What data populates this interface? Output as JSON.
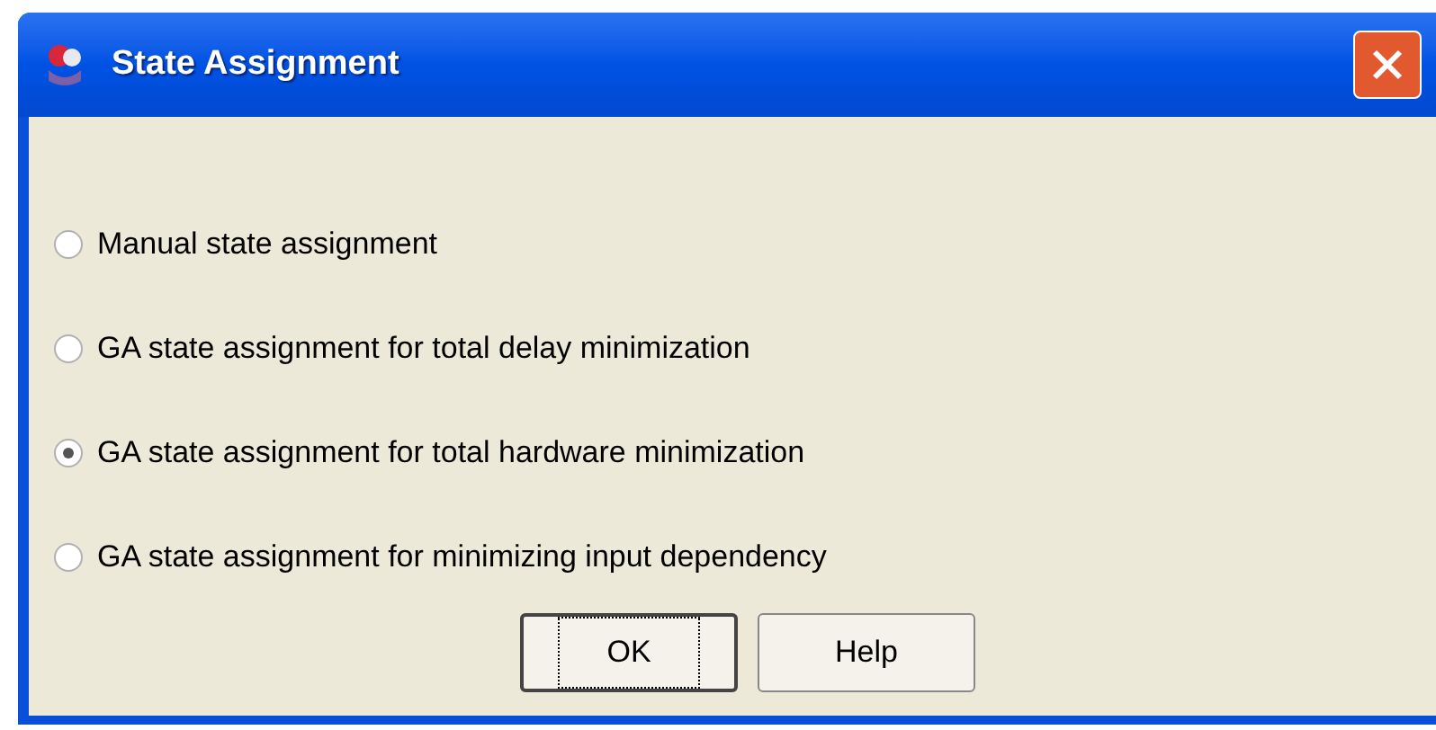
{
  "window": {
    "title": "State Assignment"
  },
  "options": [
    {
      "label": "Manual state assignment",
      "selected": false
    },
    {
      "label": "GA state assignment for total delay minimization",
      "selected": false
    },
    {
      "label": "GA state assignment for total hardware minimization",
      "selected": true
    },
    {
      "label": "GA state assignment for minimizing input dependency",
      "selected": false
    }
  ],
  "buttons": [
    {
      "label": "OK",
      "focused": true
    },
    {
      "label": "Help",
      "focused": false
    }
  ]
}
